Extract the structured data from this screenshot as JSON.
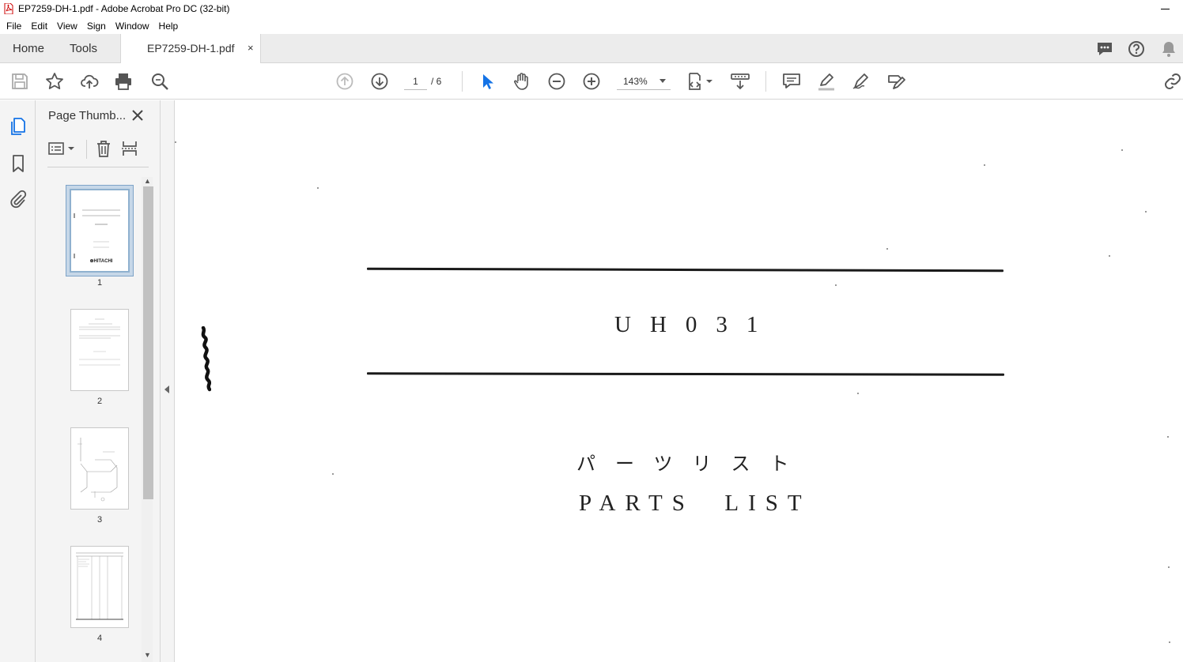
{
  "window": {
    "title": "EP7259-DH-1.pdf - Adobe Acrobat Pro DC (32-bit)"
  },
  "menu": [
    "File",
    "Edit",
    "View",
    "Sign",
    "Window",
    "Help"
  ],
  "tabs": {
    "home": "Home",
    "tools": "Tools",
    "document": "EP7259-DH-1.pdf",
    "close": "×"
  },
  "toolbar": {
    "current_page": "1",
    "page_total": "/ 6",
    "zoom": "143%"
  },
  "panel": {
    "title": "Page Thumb...",
    "thumbnails": [
      {
        "label": "1",
        "selected": true
      },
      {
        "label": "2",
        "selected": false
      },
      {
        "label": "3",
        "selected": false
      },
      {
        "label": "4",
        "selected": false
      }
    ]
  },
  "document": {
    "model": "UH031",
    "japanese_title": "パーツリスト",
    "english_title": "PARTS  LIST"
  },
  "colors": {
    "accent": "#1473e6",
    "tab_bar": "#ececec",
    "panel_bg": "#f4f4f4",
    "icon": "#555555"
  }
}
